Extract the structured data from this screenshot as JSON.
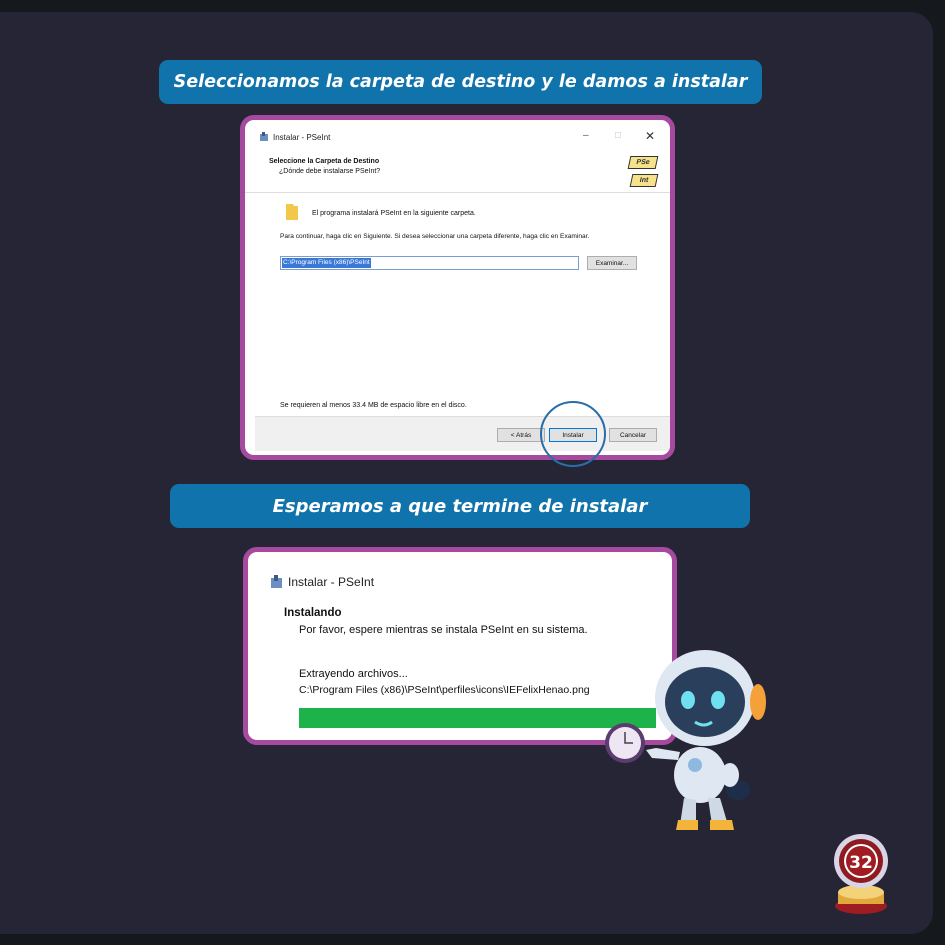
{
  "step1": {
    "banner": "Seleccionamos la carpeta de destino y le damos a instalar",
    "window": {
      "title": "Instalar - PSeInt",
      "heading": "Seleccione la Carpeta de Destino",
      "subheading": "¿Dónde debe instalarse PSeInt?",
      "info": "El programa instalará PSeInt en la siguiente carpeta.",
      "instruction": "Para continuar, haga clic en Siguiente. Si desea seleccionar una carpeta diferente, haga clic en Examinar.",
      "path_value": "C:\\Program Files (x86)\\PSeInt",
      "browse_label": "Examinar...",
      "space_note": "Se requieren al menos 33.4 MB de espacio libre en el disco.",
      "back_label": "< Atrás",
      "install_label": "Instalar",
      "cancel_label": "Cancelar",
      "logo_top": "PSe",
      "logo_bottom": "Int"
    }
  },
  "step2": {
    "banner": "Esperamos a que termine de instalar",
    "window": {
      "title": "Instalar - PSeInt",
      "heading": "Instalando",
      "subheading": "Por favor, espere mientras se instala PSeInt en su sistema.",
      "status": "Extrayendo archivos...",
      "current_file": "C:\\Program Files (x86)\\PSeInt\\perfiles\\icons\\IEFelixHenao.png",
      "progress": 1.0
    }
  },
  "badge": {
    "number": "32"
  },
  "colors": {
    "background": "#252535",
    "banner": "#1173ac",
    "frame": "#a64aa0",
    "progress": "#1eb34a",
    "highlight_circle": "#2a6da8"
  }
}
